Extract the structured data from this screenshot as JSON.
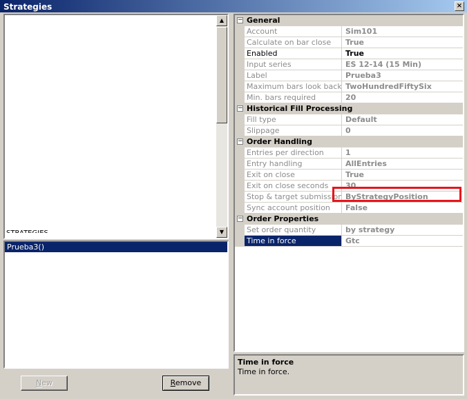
{
  "window": {
    "title": "Strategies",
    "close_glyph": "×"
  },
  "left": {
    "clipped_text": "STRATEGIES",
    "selected_strategy": "Prueba3()",
    "scroll_up_glyph": "▲",
    "scroll_down_glyph": "▼"
  },
  "buttons": {
    "new_prefix": "N",
    "new_rest": "ew",
    "remove_prefix": "R",
    "remove_rest": "emove"
  },
  "grid": {
    "categories": [
      {
        "label": "General",
        "rows": [
          {
            "name": "Account",
            "value": "Sim101"
          },
          {
            "name": "Calculate on bar close",
            "value": "True"
          },
          {
            "name": "Enabled",
            "value": "True"
          },
          {
            "name": "Input series",
            "value": "ES 12-14 (15 Min)"
          },
          {
            "name": "Label",
            "value": "Prueba3"
          },
          {
            "name": "Maximum bars look back",
            "value": "TwoHundredFiftySix"
          },
          {
            "name": "Min. bars required",
            "value": "20"
          }
        ]
      },
      {
        "label": "Historical Fill Processing",
        "rows": [
          {
            "name": "Fill type",
            "value": "Default"
          },
          {
            "name": "Slippage",
            "value": "0"
          }
        ]
      },
      {
        "label": "Order Handling",
        "rows": [
          {
            "name": "Entries per direction",
            "value": "1"
          },
          {
            "name": "Entry handling",
            "value": "AllEntries"
          },
          {
            "name": "Exit on close",
            "value": "True"
          },
          {
            "name": "Exit on close seconds",
            "value": "30"
          },
          {
            "name": "Stop & target submission",
            "value": "ByStrategyPosition"
          },
          {
            "name": "Sync account position",
            "value": "False"
          }
        ]
      },
      {
        "label": "Order Properties",
        "rows": [
          {
            "name": "Set order quantity",
            "value": "by strategy"
          },
          {
            "name": "Time in force",
            "value": "Gtc"
          }
        ]
      }
    ]
  },
  "help": {
    "title": "Time in force",
    "description": "Time in force."
  },
  "colors": {
    "selection": "#0a246a",
    "highlight_box": "#e8141c",
    "disabled_text": "#8c8c8c"
  }
}
